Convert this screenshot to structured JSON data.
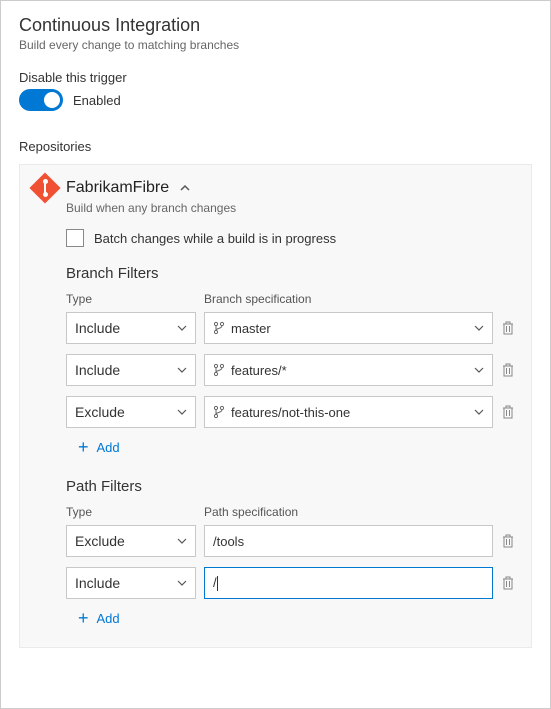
{
  "header": {
    "title": "Continuous Integration",
    "subtitle": "Build every change to matching branches"
  },
  "trigger": {
    "label": "Disable this trigger",
    "state": "Enabled"
  },
  "repositoriesLabel": "Repositories",
  "repo": {
    "name": "FabrikamFibre",
    "desc": "Build when any branch changes",
    "batchLabel": "Batch changes while a build is in progress"
  },
  "branchFilters": {
    "title": "Branch Filters",
    "typeHeader": "Type",
    "specHeader": "Branch specification",
    "rows": [
      {
        "type": "Include",
        "spec": "master"
      },
      {
        "type": "Include",
        "spec": "features/*"
      },
      {
        "type": "Exclude",
        "spec": "features/not-this-one"
      }
    ],
    "add": "Add"
  },
  "pathFilters": {
    "title": "Path Filters",
    "typeHeader": "Type",
    "specHeader": "Path specification",
    "rows": [
      {
        "type": "Exclude",
        "spec": "/tools",
        "active": false
      },
      {
        "type": "Include",
        "spec": "/",
        "active": true
      }
    ],
    "add": "Add"
  }
}
